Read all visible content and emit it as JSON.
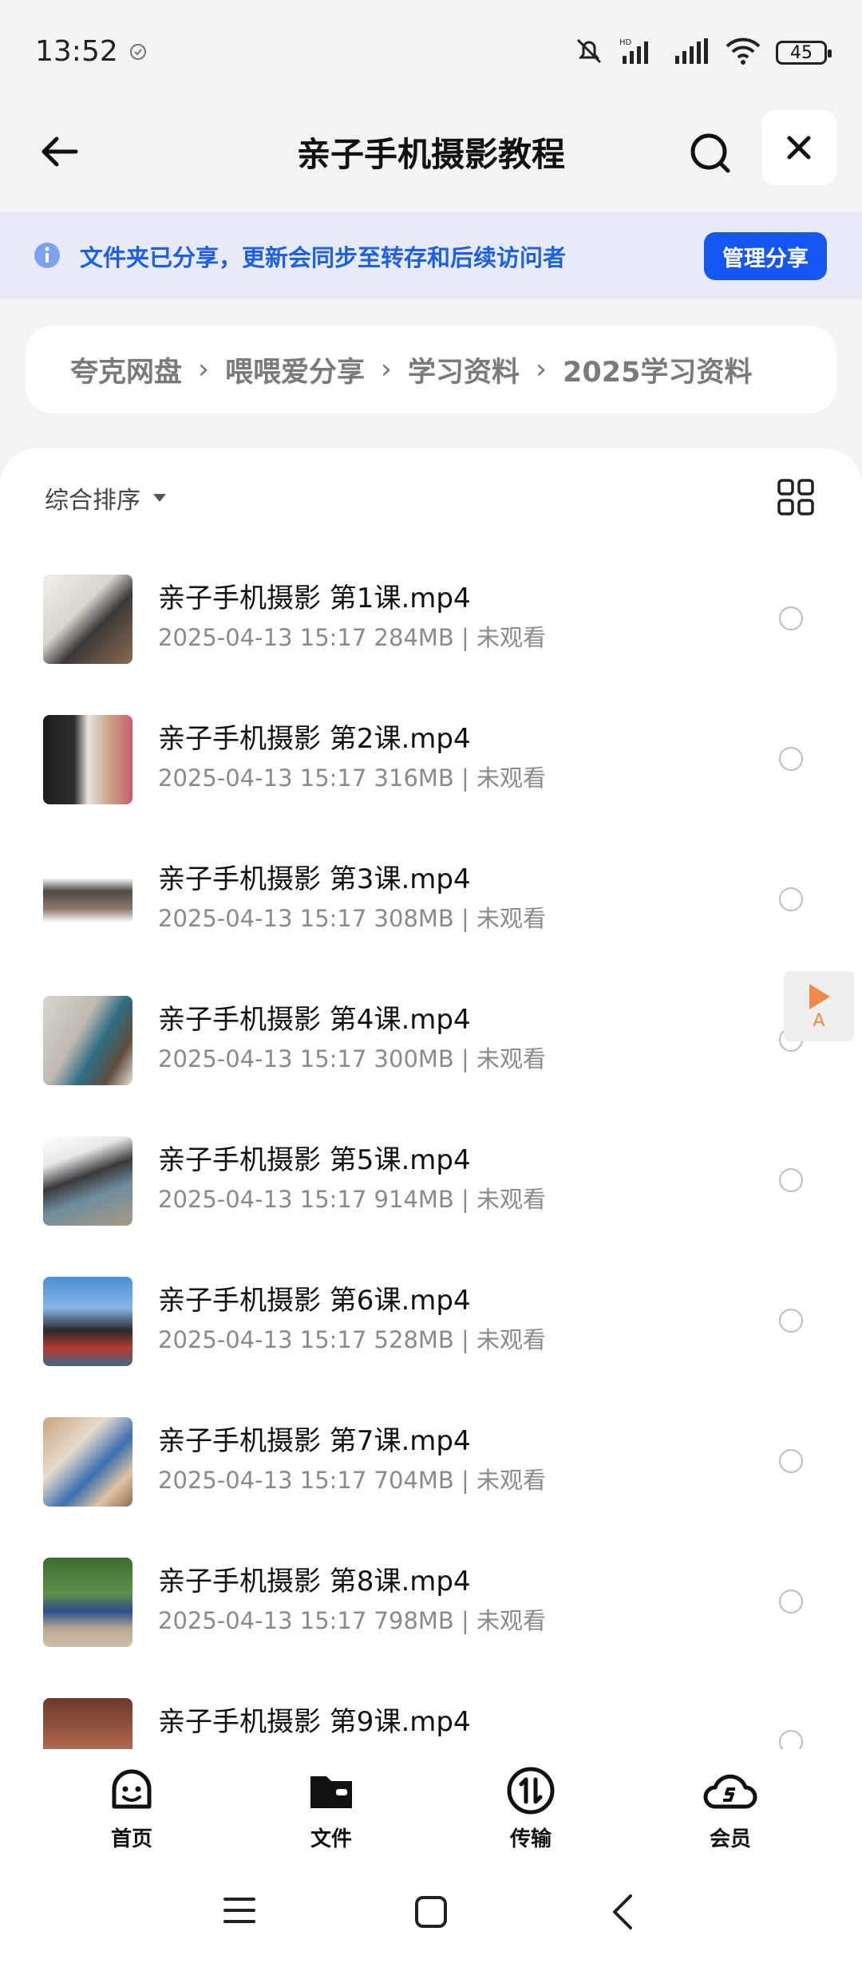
{
  "status": {
    "time": "13:52",
    "battery": "45"
  },
  "header": {
    "title": "亲子手机摄影教程"
  },
  "share_banner": {
    "message": "文件夹已分享，更新会同步至转存和后续访问者",
    "manage_label": "管理分享"
  },
  "breadcrumb": [
    "夸克网盘",
    "喂喂爱分享",
    "学习资料",
    "2025学习资料"
  ],
  "sort": {
    "label": "综合排序"
  },
  "files": [
    {
      "name": "亲子手机摄影 第1课.mp4",
      "meta": "2025-04-13 15:17  284MB | 未观看"
    },
    {
      "name": "亲子手机摄影 第2课.mp4",
      "meta": "2025-04-13 15:17  316MB | 未观看"
    },
    {
      "name": "亲子手机摄影 第3课.mp4",
      "meta": "2025-04-13 15:17  308MB | 未观看"
    },
    {
      "name": "亲子手机摄影 第4课.mp4",
      "meta": "2025-04-13 15:17  300MB | 未观看"
    },
    {
      "name": "亲子手机摄影 第5课.mp4",
      "meta": "2025-04-13 15:17  914MB | 未观看"
    },
    {
      "name": "亲子手机摄影 第6课.mp4",
      "meta": "2025-04-13 15:17  528MB | 未观看"
    },
    {
      "name": "亲子手机摄影 第7课.mp4",
      "meta": "2025-04-13 15:17  704MB | 未观看"
    },
    {
      "name": "亲子手机摄影 第8课.mp4",
      "meta": "2025-04-13 15:17  798MB | 未观看"
    },
    {
      "name": "亲子手机摄影 第9课.mp4",
      "meta": ""
    }
  ],
  "float_button": {
    "label": "A"
  },
  "tabs": [
    {
      "label": "首页",
      "icon": "smiley-icon"
    },
    {
      "label": "文件",
      "icon": "folder-icon"
    },
    {
      "label": "传输",
      "icon": "transfer-icon"
    },
    {
      "label": "会员",
      "icon": "cloud-s-icon"
    }
  ],
  "colors": {
    "accent": "#1457f5",
    "banner_text": "#1d5fe6",
    "banner_bg": "#e6ebf7"
  }
}
